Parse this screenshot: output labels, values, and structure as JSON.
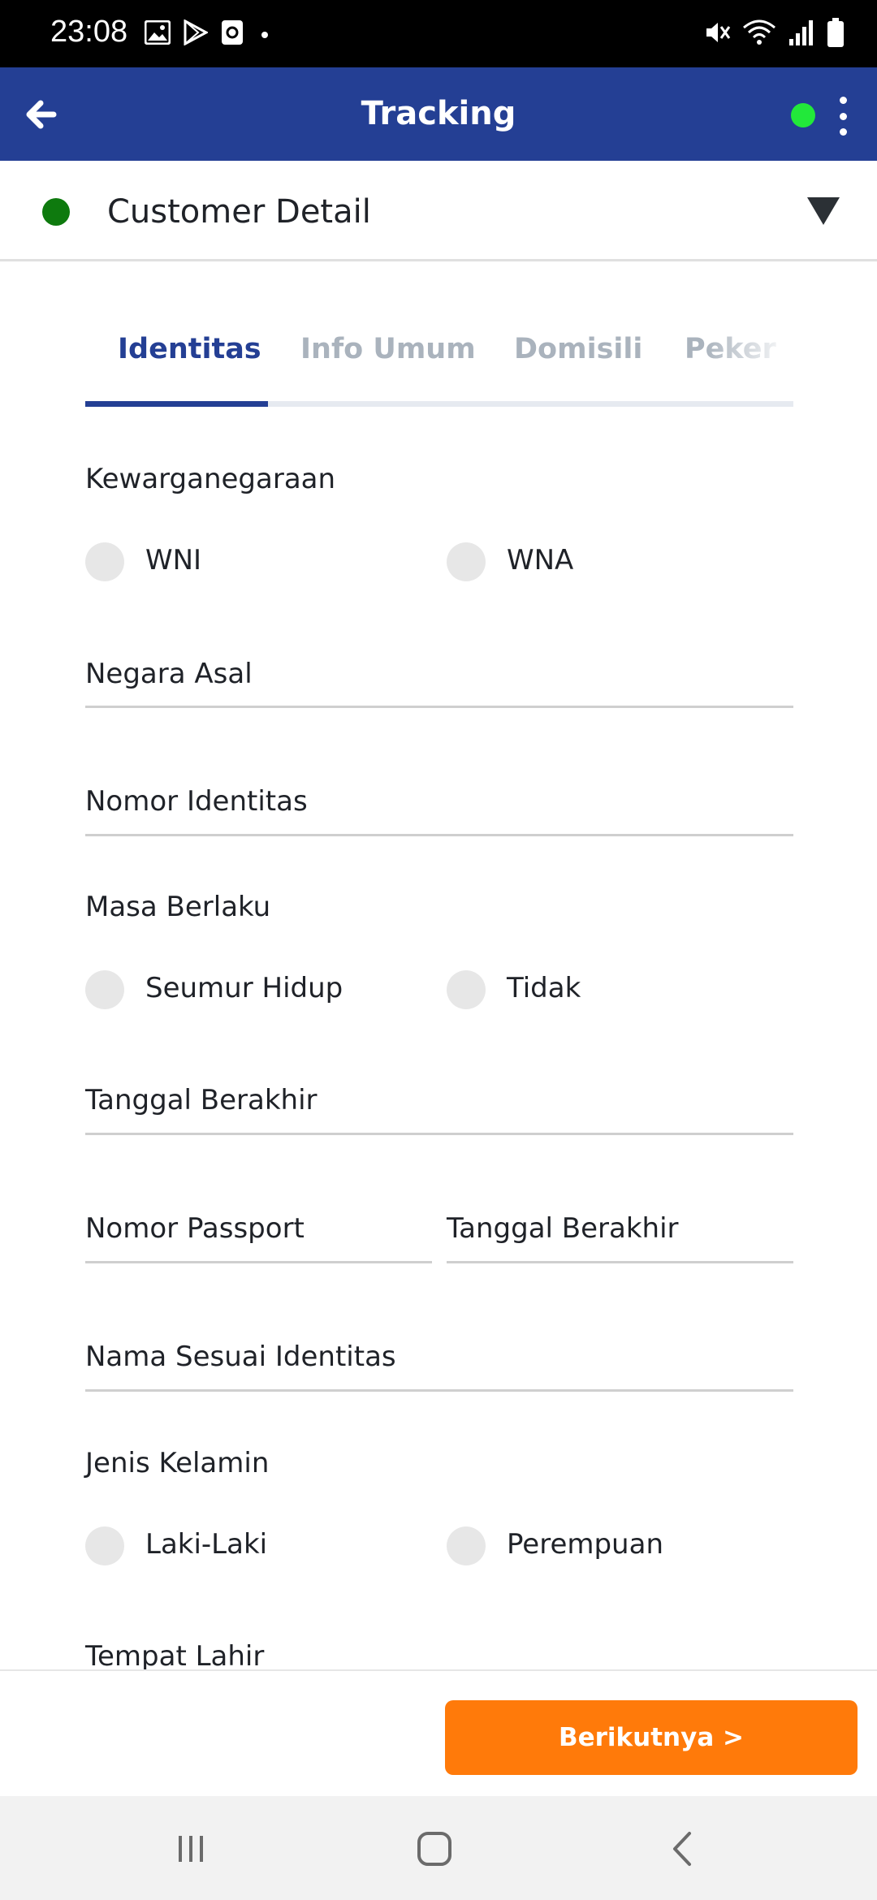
{
  "status_bar": {
    "time": "23:08",
    "left_icons": [
      "gallery-icon",
      "play-store-icon",
      "screen-record-icon",
      "dot-icon"
    ],
    "right_icons": [
      "mute-icon",
      "wifi-icon",
      "signal-icon",
      "battery-icon"
    ]
  },
  "app_bar": {
    "title": "Tracking",
    "back_icon": "arrow-left-icon",
    "status_color": "#22e83a",
    "menu_icon": "more-vertical-icon"
  },
  "section": {
    "title": "Customer Detail",
    "status_color": "#0e7a0e",
    "toggle_icon": "caret-down-icon"
  },
  "tabs": [
    {
      "label": "Identitas",
      "active": true
    },
    {
      "label": "Info Umum",
      "active": false
    },
    {
      "label": "Domisili",
      "active": false
    },
    {
      "label": "Peker",
      "active": false
    }
  ],
  "form": {
    "kewarganegaraan": {
      "label": "Kewarganegaraan",
      "options": [
        "WNI",
        "WNA"
      ]
    },
    "negara_asal": {
      "label": "Negara Asal"
    },
    "nomor_identitas": {
      "label": "Nomor Identitas"
    },
    "masa_berlaku": {
      "label": "Masa Berlaku",
      "options": [
        "Seumur Hidup",
        "Tidak"
      ]
    },
    "tanggal_berakhir": {
      "label": "Tanggal Berakhir"
    },
    "nomor_passport": {
      "label": "Nomor Passport"
    },
    "tanggal_berakhir_passport": {
      "label": "Tanggal Berakhir"
    },
    "nama_sesuai_identitas": {
      "label": "Nama Sesuai Identitas"
    },
    "jenis_kelamin": {
      "label": "Jenis Kelamin",
      "options": [
        "Laki-Laki",
        "Perempuan"
      ]
    },
    "tempat_lahir": {
      "label": "Tempat Lahir"
    }
  },
  "footer": {
    "next_label": "Berikutnya >",
    "next_color": "#ff7a0a"
  },
  "nav_bar": {
    "items": [
      "recent-apps-icon",
      "home-icon",
      "back-icon"
    ]
  }
}
